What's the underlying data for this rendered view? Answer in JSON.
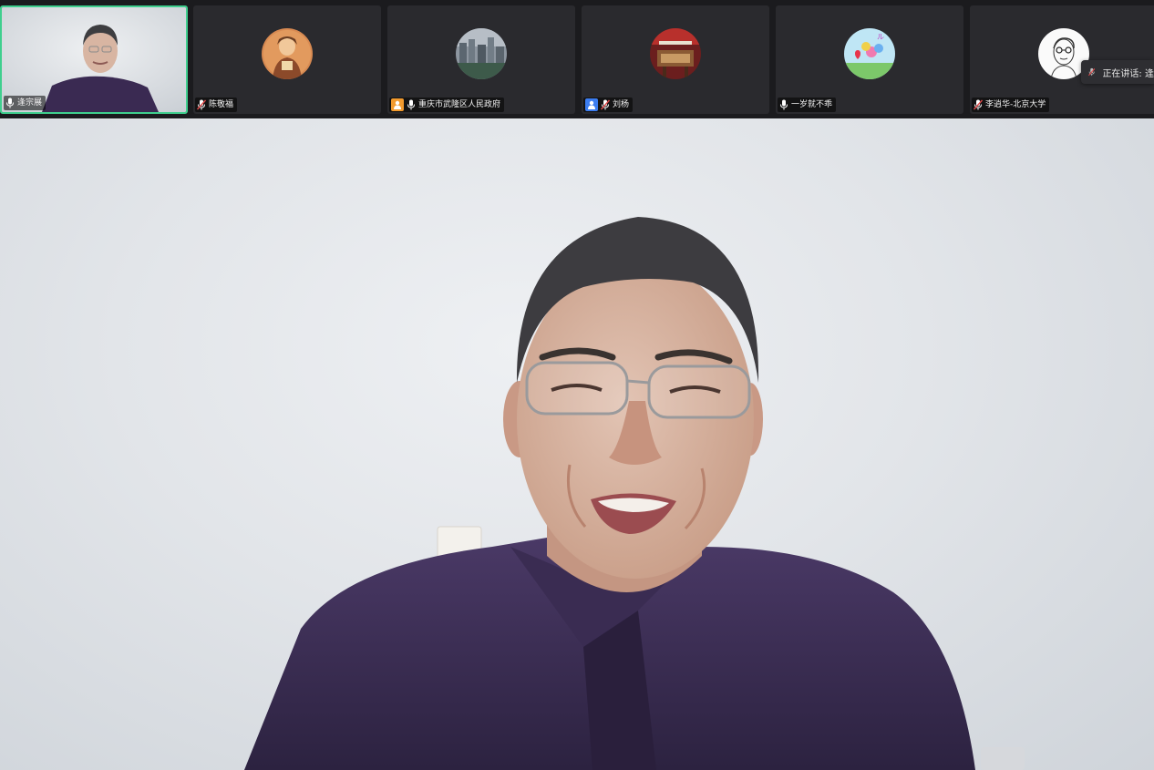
{
  "participants": [
    {
      "name": "逢宗展",
      "mic": "on",
      "avatar": "video-thumbnail-man",
      "active": true
    },
    {
      "name": "陈敬福",
      "mic": "muted",
      "avatar": "painted-portrait-avatar"
    },
    {
      "name": "重庆市武隆区人民政府",
      "mic": "on",
      "avatar": "city-photo-avatar",
      "badge": "person-icon",
      "badge_color": "#f29a2e"
    },
    {
      "name": "刘杨",
      "mic": "muted",
      "avatar": "red-room-avatar",
      "badge": "person-icon",
      "badge_color": "#3c7df0"
    },
    {
      "name": "一岁就不乖",
      "mic": "on",
      "avatar": "cartoon-flowers-avatar"
    },
    {
      "name": "李逍华-北京大学",
      "mic": "muted",
      "avatar": "sketch-portrait-avatar"
    }
  ],
  "speaking": {
    "label": "正在讲话: 逢"
  },
  "colors": {
    "active_border": "#3fcf8e",
    "tile_bg": "#2a2a2e",
    "app_bg": "#1b1b1e"
  }
}
